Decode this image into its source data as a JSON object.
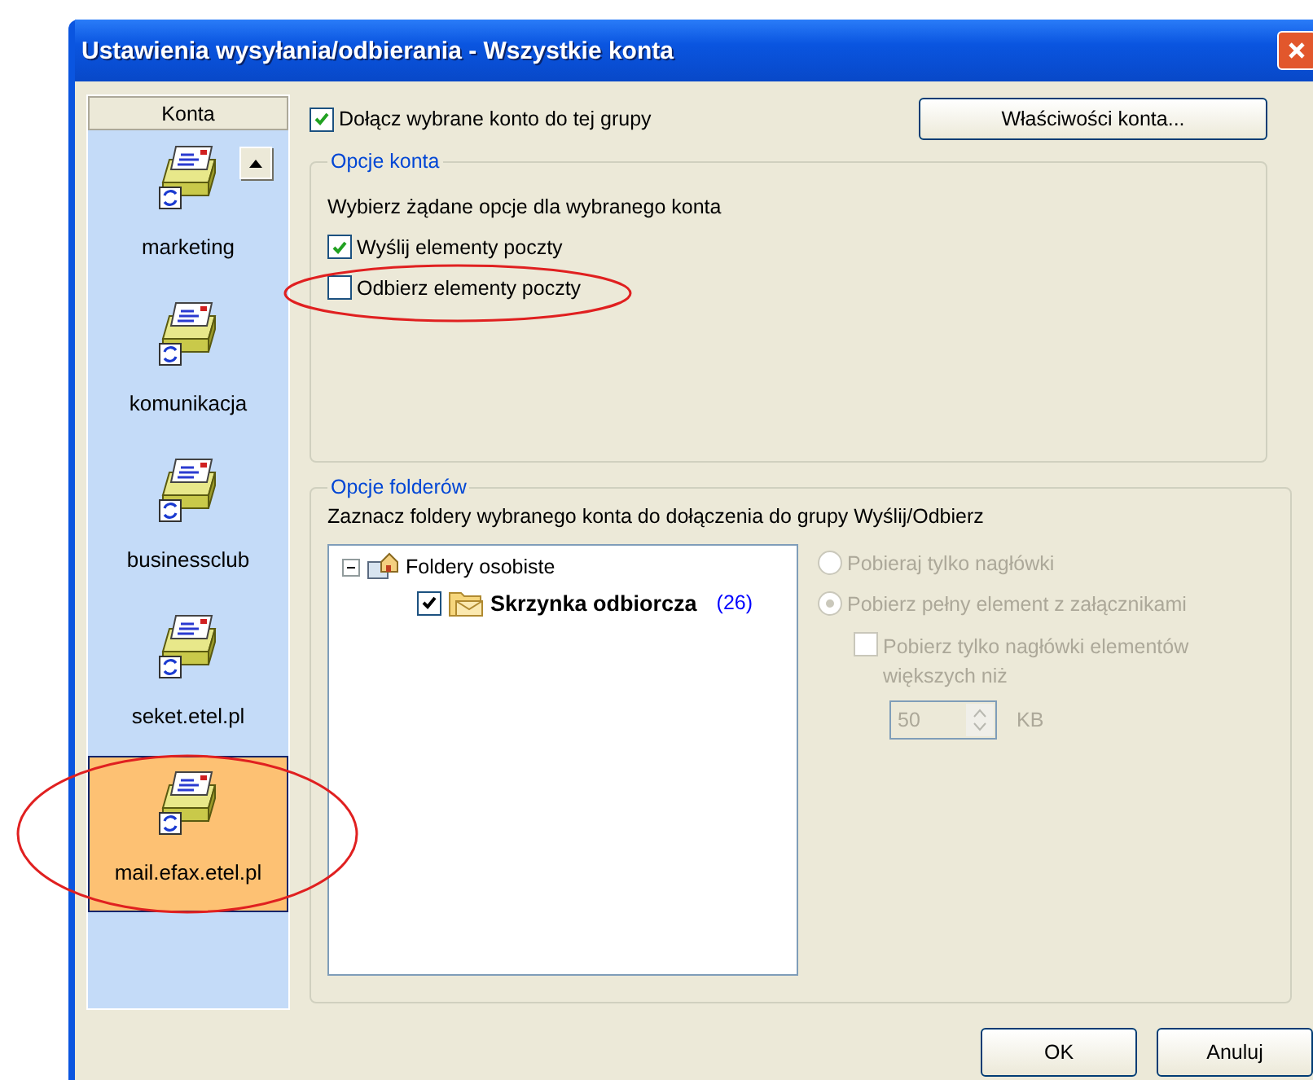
{
  "window": {
    "title": "Ustawienia wysyłania/odbierania - Wszystkie konta"
  },
  "accounts": {
    "header": "Konta",
    "items": [
      {
        "name": "marketing",
        "selected": false
      },
      {
        "name": "komunikacja",
        "selected": false
      },
      {
        "name": "businessclub",
        "selected": false
      },
      {
        "name": "seket.etel.pl",
        "selected": false
      },
      {
        "name": "mail.efax.etel.pl",
        "selected": true
      }
    ]
  },
  "include_checkbox": {
    "label": "Dołącz wybrane konto do tej grupy",
    "checked": true
  },
  "properties_button": "Właściwości konta...",
  "account_options": {
    "title": "Opcje konta",
    "hint": "Wybierz żądane opcje dla wybranego konta",
    "options": [
      {
        "label": "Wyślij elementy poczty",
        "checked": true
      },
      {
        "label": "Odbierz elementy poczty",
        "checked": false
      }
    ]
  },
  "folder_options": {
    "title": "Opcje folderów",
    "hint": "Zaznacz foldery wybranego konta do dołączenia do grupy Wyślij/Odbierz",
    "tree": [
      {
        "label": "Foldery osobiste",
        "expanded": true,
        "children": [
          {
            "label": "Skrzynka odbiorcza",
            "count": "(26)",
            "checked": true
          }
        ]
      }
    ],
    "download": [
      {
        "label": "Pobieraj tylko nagłówki",
        "selected": false,
        "disabled": true
      },
      {
        "label": "Pobierz pełny element z załącznikami",
        "selected": true,
        "disabled": true
      }
    ],
    "size_limit": {
      "label": "Pobierz tylko nagłówki elementów większych niż",
      "checked": false,
      "disabled": true,
      "value": "50",
      "unit": "KB"
    }
  },
  "buttons": [
    "OK",
    "Anuluj"
  ]
}
